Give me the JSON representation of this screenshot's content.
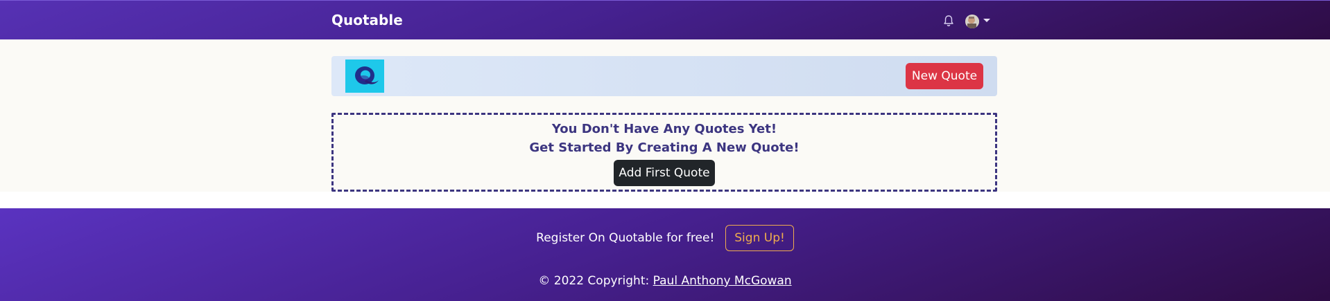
{
  "navbar": {
    "brand": "Quotable",
    "icons": [
      "bell-icon",
      "user-avatar",
      "chevron-down-icon"
    ]
  },
  "toolbar": {
    "logo_icon": "quotable-logo",
    "new_quote_label": "New Quote"
  },
  "empty_state": {
    "line1": "You Don't Have Any Quotes Yet!",
    "line2": "Get Started By Creating A New Quote!",
    "button_label": "Add First Quote"
  },
  "footer": {
    "register_text": "Register On Quotable for free!",
    "signup_label": "Sign Up!",
    "copyright_prefix": "© 2022 Copyright: ",
    "copyright_link": "Paul Anthony McGowan"
  },
  "colors": {
    "nav_gradient_start": "#5631b4",
    "nav_gradient_end": "#2e0c45",
    "danger": "#dc3545",
    "dark_button": "#212529",
    "empty_text": "#3c3580",
    "signup_outline": "#f0ad4e",
    "logo_tile": "#1ec8ea"
  }
}
